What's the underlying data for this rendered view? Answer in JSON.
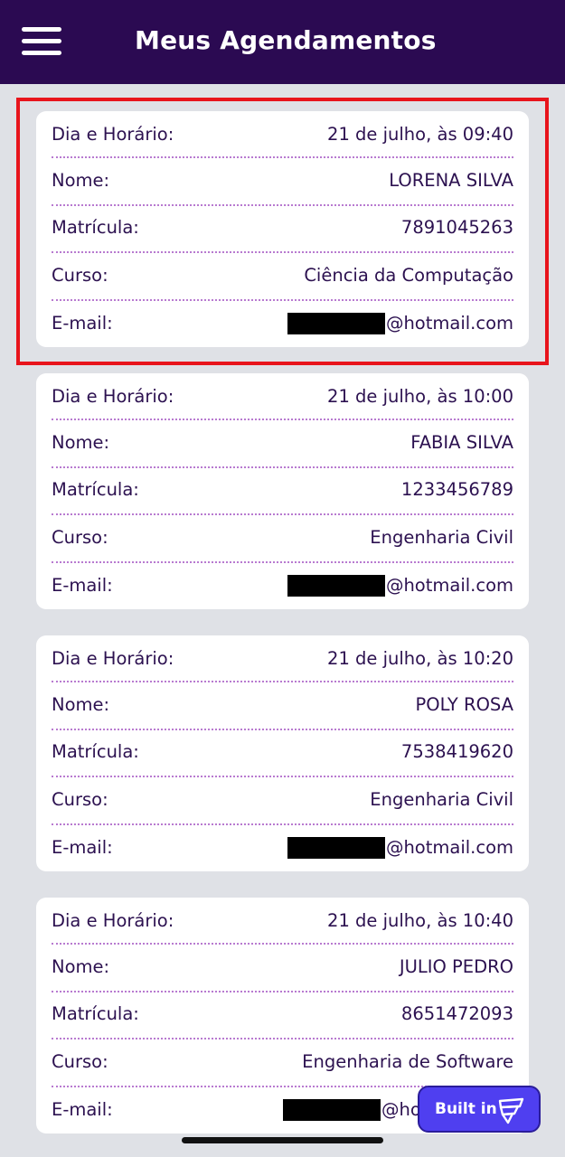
{
  "app_bar": {
    "title": "Meus Agendamentos",
    "menu_icon": "hamburger-menu-icon",
    "background": "#2b0a52"
  },
  "labels": {
    "datetime": "Dia e Horário:",
    "name": "Nome:",
    "registration": "Matrícula:",
    "course": "Curso:",
    "email": "E-mail:"
  },
  "appointments": [
    {
      "datetime": "21 de julho, às 09:40",
      "name": "LORENA SILVA",
      "registration": "7891045263",
      "course": "Ciência da Computação",
      "email_domain": "@hotmail.com"
    },
    {
      "datetime": "21 de julho, às 10:00",
      "name": "FABIA SILVA",
      "registration": "1233456789",
      "course": "Engenharia Civil",
      "email_domain": "@hotmail.com"
    },
    {
      "datetime": "21 de julho, às 10:20",
      "name": "POLY ROSA",
      "registration": "7538419620",
      "course": "Engenharia Civil",
      "email_domain": "@hotmail.com"
    },
    {
      "datetime": "21 de julho, às 10:40",
      "name": "JULIO PEDRO",
      "registration": "8651472093",
      "course": "Engenharia de Software",
      "email_domain": "@ho"
    }
  ],
  "badge": {
    "label": "Built in",
    "icon": "builder-logo-icon",
    "color": "#4f3ff0"
  },
  "highlight_color": "#e8141c"
}
